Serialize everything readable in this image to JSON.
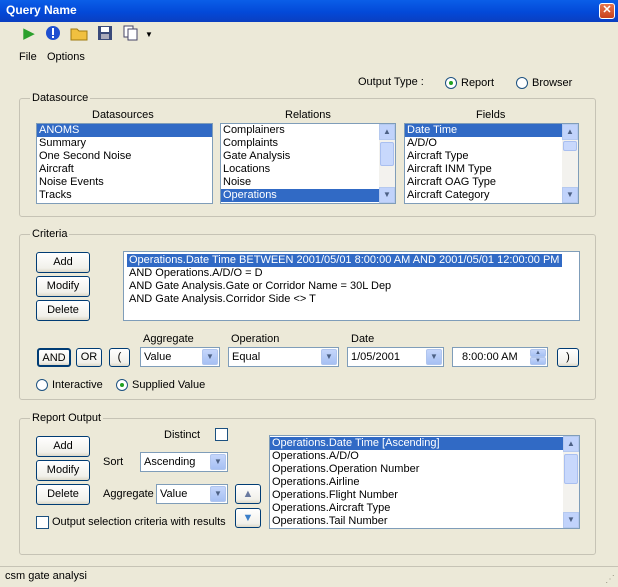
{
  "window": {
    "title": "Query Name"
  },
  "menu": {
    "file": "File",
    "options": "Options"
  },
  "output_type": {
    "label": "Output Type :",
    "report": "Report",
    "browser": "Browser",
    "selected": "Report"
  },
  "datasource": {
    "title": "Datasource",
    "datasources_header": "Datasources",
    "relations_header": "Relations",
    "fields_header": "Fields",
    "datasources": [
      "ANOMS",
      "Summary",
      "One Second Noise",
      "Aircraft",
      "Noise Events",
      "Tracks"
    ],
    "relations": [
      "Complainers",
      "Complaints",
      "Gate Analysis",
      "Locations",
      "Noise",
      "Operations"
    ],
    "fields": [
      "Date Time",
      "A/D/O",
      "Aircraft Type",
      "Aircraft INM Type",
      "Aircraft OAG Type",
      "Aircraft Category"
    ]
  },
  "criteria": {
    "title": "Criteria",
    "add": "Add",
    "modify": "Modify",
    "delete": "Delete",
    "lines": [
      "Operations.Date Time BETWEEN 2001/05/01 8:00:00 AM AND 2001/05/01 12:00:00 PM",
      "AND Operations.A/D/O = D",
      "AND Gate Analysis.Gate or Corridor Name = 30L Dep",
      "AND Gate Analysis.Corridor Side <> T"
    ],
    "and": "AND",
    "or": "OR",
    "open_paren": "(",
    "close_paren": ")",
    "aggregate_label": "Aggregate",
    "aggregate_value": "Value",
    "operation_label": "Operation",
    "operation_value": "Equal",
    "date_label": "Date",
    "date_value": "1/05/2001",
    "time_value": "8:00:00 AM",
    "interactive": "Interactive",
    "supplied": "Supplied Value",
    "selected_mode": "Supplied Value"
  },
  "report_output": {
    "title": "Report Output",
    "add": "Add",
    "modify": "Modify",
    "delete": "Delete",
    "distinct": "Distinct",
    "sort_label": "Sort",
    "sort_value": "Ascending",
    "aggregate_label": "Aggregate",
    "aggregate_value": "Value",
    "output_criteria": "Output selection criteria with results",
    "fields": [
      "Operations.Date Time [Ascending]",
      "Operations.A/D/O",
      "Operations.Operation Number",
      "Operations.Airline",
      "Operations.Flight Number",
      "Operations.Aircraft Type",
      "Operations.Tail Number"
    ]
  },
  "status": {
    "text": "csm gate analysi"
  }
}
